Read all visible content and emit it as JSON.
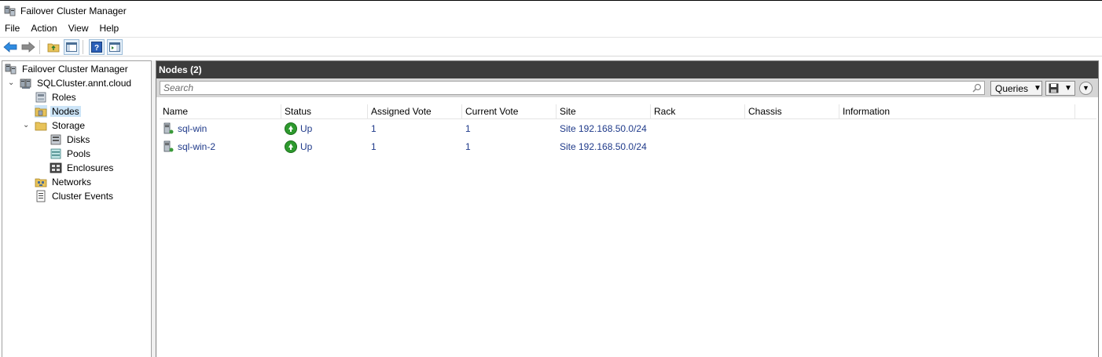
{
  "window": {
    "title": "Failover Cluster Manager"
  },
  "menu": [
    "File",
    "Action",
    "View",
    "Help"
  ],
  "tree": {
    "root": "Failover Cluster Manager",
    "cluster": "SQLCluster.annt.cloud",
    "roles": "Roles",
    "nodes": "Nodes",
    "storage": "Storage",
    "disks": "Disks",
    "pools": "Pools",
    "enclosures": "Enclosures",
    "networks": "Networks",
    "events": "Cluster Events",
    "selected": "Nodes"
  },
  "panel": {
    "title": "Nodes (2)",
    "search_placeholder": "Search",
    "queries_label": "Queries"
  },
  "grid": {
    "headers": {
      "name": "Name",
      "status": "Status",
      "assigned_vote": "Assigned Vote",
      "current_vote": "Current Vote",
      "site": "Site",
      "rack": "Rack",
      "chassis": "Chassis",
      "information": "Information"
    },
    "rows": [
      {
        "name": "sql-win",
        "status": "Up",
        "assigned_vote": "1",
        "current_vote": "1",
        "site": "Site 192.168.50.0/24",
        "rack": "",
        "chassis": "",
        "information": ""
      },
      {
        "name": "sql-win-2",
        "status": "Up",
        "assigned_vote": "1",
        "current_vote": "1",
        "site": "Site 192.168.50.0/24",
        "rack": "",
        "chassis": "",
        "information": ""
      }
    ]
  },
  "colors": {
    "header_bg": "#3c3c3c",
    "link_text": "#1f3a8a",
    "status_up": "#2e9a2e",
    "selection": "#cce4f7"
  },
  "icons": {
    "app": "cluster-icon",
    "back": "back-arrow-icon",
    "forward": "forward-arrow-icon",
    "status_up": "up-arrow-circle-icon"
  }
}
